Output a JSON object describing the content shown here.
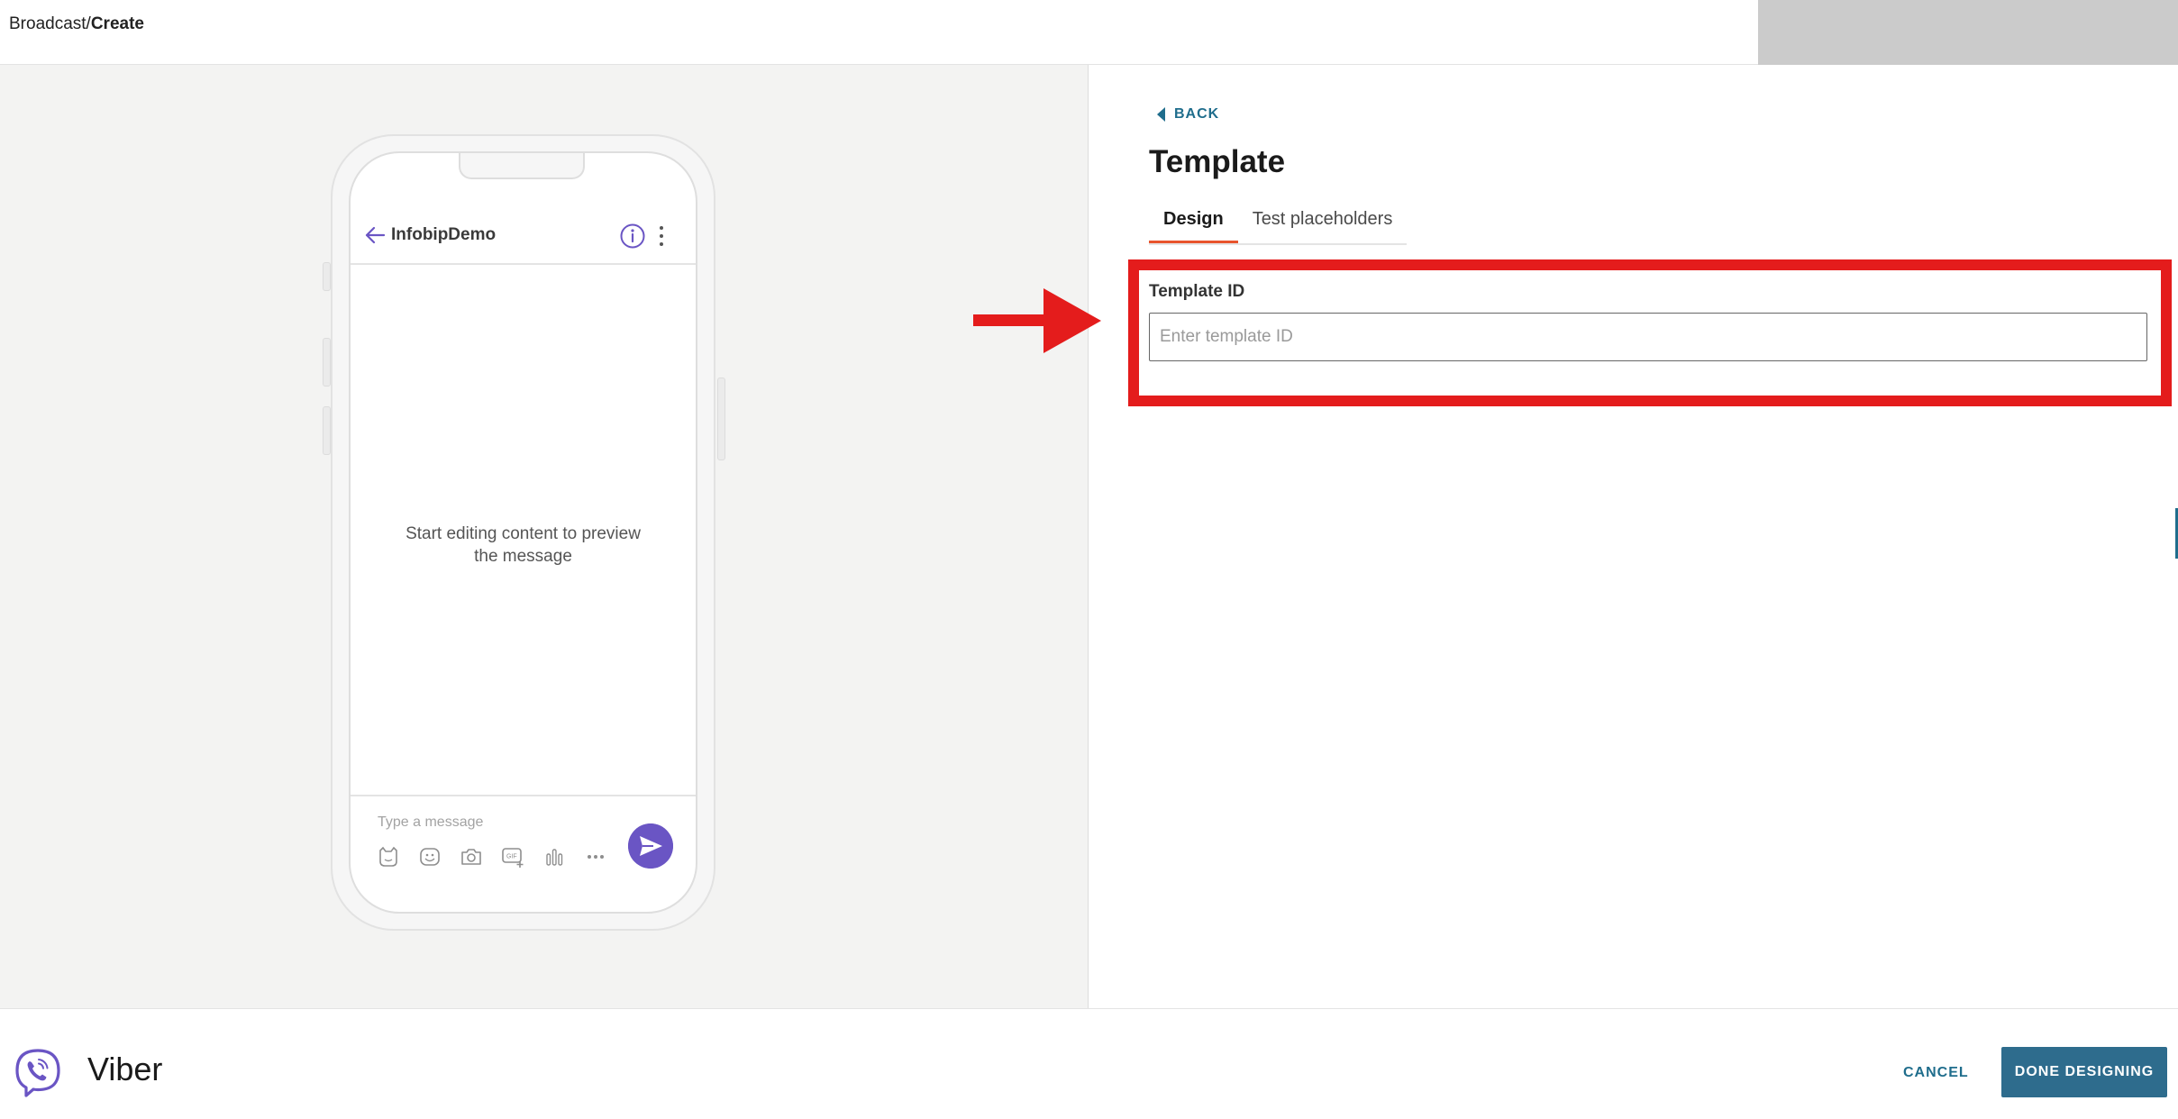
{
  "breadcrumb": {
    "parent": "Broadcast",
    "separator": "/",
    "current": "Create"
  },
  "preview": {
    "chat_title": "InfobipDemo",
    "empty_message": "Start editing content to preview the message",
    "composer_placeholder": "Type a message",
    "composer_icons": [
      "sticker-icon",
      "emoji-icon",
      "camera-icon",
      "gif-icon",
      "poll-icon",
      "more-icon"
    ],
    "send_icon": "send-icon"
  },
  "editor": {
    "back_label": "BACK",
    "title": "Template",
    "tabs": [
      {
        "label": "Design",
        "active": true
      },
      {
        "label": "Test placeholders",
        "active": false
      }
    ],
    "template_id": {
      "label": "Template ID",
      "value": "",
      "placeholder": "Enter template ID"
    }
  },
  "footer": {
    "channel_name": "Viber",
    "cancel_label": "CANCEL",
    "done_label": "DONE DESIGNING"
  },
  "colors": {
    "accent": "#1f6d8c",
    "primary_button": "#2e6c8d",
    "viber_purple": "#6a55c4",
    "annotation_red": "#e41c1c",
    "tab_underline": "#e8542d"
  }
}
